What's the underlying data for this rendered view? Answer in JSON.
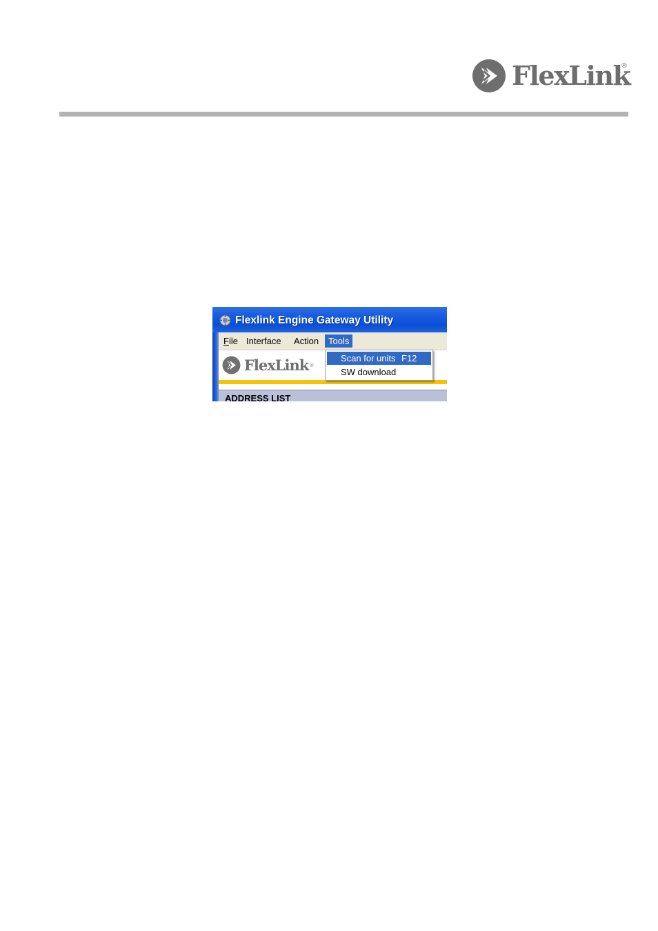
{
  "header": {
    "brand_name": "FlexLink",
    "brand_reg": "®"
  },
  "app": {
    "title": "Flexlink Engine Gateway Utility",
    "menu": [
      {
        "label": "File",
        "mnemonic": "F",
        "rest": "ile"
      },
      {
        "label": "Interface"
      },
      {
        "label": "Action"
      },
      {
        "label": "Tools",
        "active": true
      }
    ],
    "logo_text": "FlexLink",
    "logo_reg": "®",
    "address_list_label": "ADDRESS LIST",
    "tools_menu": [
      {
        "label": "Scan for units",
        "shortcut": "F12",
        "highlighted": true
      },
      {
        "label": "SW download",
        "shortcut": ""
      }
    ]
  },
  "colors": {
    "brand_gray": "#6e6e6e",
    "rule_gray": "#b3b3b3",
    "xp_title_blue": "#0a4fd6",
    "menu_highlight": "#316ac5",
    "accent_yellow": "#f5c400"
  },
  "icons": {
    "brand_mark": "flexlink-chevron-logo-icon",
    "app_icon": "gear-globe-icon"
  }
}
